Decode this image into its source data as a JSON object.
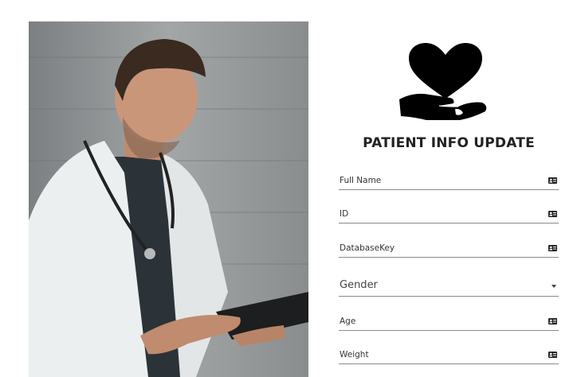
{
  "page": {
    "title": "PATIENT INFO UPDATE"
  },
  "icons": {
    "logo": "heart-in-hand-icon",
    "field_icon": "id-card-icon",
    "dropdown": "caret-down-icon"
  },
  "form": {
    "full_name": {
      "label": "Full Name"
    },
    "id": {
      "label": "ID"
    },
    "database_key": {
      "label": "DatabaseKey"
    },
    "gender": {
      "label": "Gender"
    },
    "age": {
      "label": "Age"
    },
    "weight": {
      "label": "Weight"
    }
  }
}
